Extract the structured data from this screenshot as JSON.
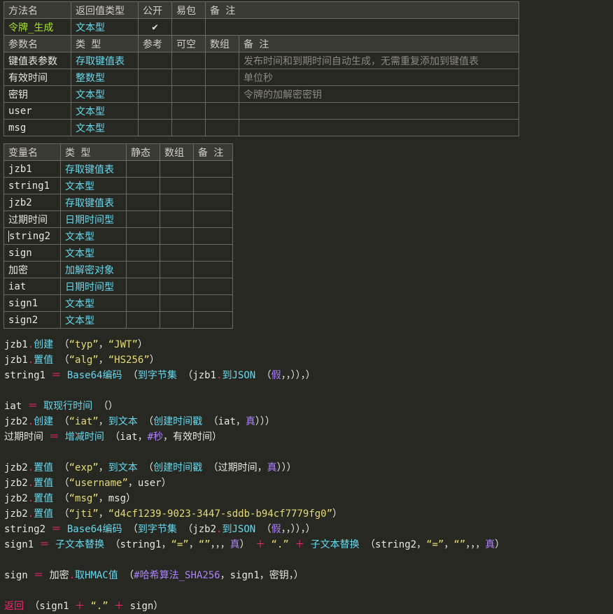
{
  "method_table": {
    "header": [
      "方法名",
      "返回值类型",
      "公开",
      "易包",
      "备 注"
    ],
    "method": {
      "name": "令牌_生成",
      "return_type": "文本型",
      "public_check": "✔",
      "easy_pkg": "",
      "note": ""
    },
    "param_header": [
      "参数名",
      "类 型",
      "参考",
      "可空",
      "数组",
      "备 注"
    ],
    "params": [
      {
        "name": "键值表参数",
        "type": "存取键值表",
        "note": "发布时间和到期时间自动生成，无需重复添加到键值表"
      },
      {
        "name": "有效时间",
        "type": "整数型",
        "note": "单位秒"
      },
      {
        "name": "密钥",
        "type": "文本型",
        "note": "令牌的加解密密钥"
      },
      {
        "name": "user",
        "type": "文本型",
        "note": ""
      },
      {
        "name": "msg",
        "type": "文本型",
        "note": ""
      }
    ]
  },
  "var_table": {
    "header": [
      "变量名",
      "类 型",
      "静态",
      "数组",
      "备 注"
    ],
    "vars": [
      {
        "name": "jzb1",
        "type": "存取键值表"
      },
      {
        "name": "string1",
        "type": "文本型"
      },
      {
        "name": "jzb2",
        "type": "存取键值表"
      },
      {
        "name": "过期时间",
        "type": "日期时间型"
      },
      {
        "name": "string2",
        "type": "文本型"
      },
      {
        "name": "sign",
        "type": "文本型"
      },
      {
        "name": "加密",
        "type": "加解密对象"
      },
      {
        "name": "iat",
        "type": "日期时间型"
      },
      {
        "name": "sign1",
        "type": "文本型"
      },
      {
        "name": "sign2",
        "type": "文本型"
      }
    ]
  },
  "code": {
    "l1": {
      "a": "jzb1",
      "b": ".",
      "c": "创建",
      "d": " （",
      "e": "“typ”",
      "f": "，",
      "g": "“JWT”",
      "h": "）"
    },
    "l2": {
      "a": "jzb1",
      "b": ".",
      "c": "置值",
      "d": " （",
      "e": "“alg”",
      "f": "，",
      "g": "“HS256”",
      "h": "）"
    },
    "l3": {
      "a": "string1",
      "b": " ＝ ",
      "c": "Base64编码",
      "d": " （",
      "e": "到字节集",
      "f": " （jzb1",
      "g": ".",
      "h": "到JSON",
      "i": " （",
      "j": "假",
      "k": "，，））",
      "l": "，）"
    },
    "l5": {
      "a": "iat",
      "b": " ＝ ",
      "c": "取现行时间",
      "d": " （）"
    },
    "l6": {
      "a": "jzb2",
      "b": ".",
      "c": "创建",
      "d": " （",
      "e": "“iat”",
      "f": "，",
      "g": "到文本",
      "h": " （",
      "i": "创建时间戳",
      "j": " （iat，",
      "k": "真",
      "l": "）））"
    },
    "l7": {
      "a": "过期时间",
      "b": " ＝ ",
      "c": "增减时间",
      "d": " （iat，",
      "e": "#秒",
      "f": "，有效时间）"
    },
    "l9": {
      "a": "jzb2",
      "b": ".",
      "c": "置值",
      "d": " （",
      "e": "“exp”",
      "f": "，",
      "g": "到文本",
      "h": " （",
      "i": "创建时间戳",
      "j": " （过期时间，",
      "k": "真",
      "l": "）））"
    },
    "l10": {
      "a": "jzb2",
      "b": ".",
      "c": "置值",
      "d": " （",
      "e": "“username”",
      "f": "，user）"
    },
    "l11": {
      "a": "jzb2",
      "b": ".",
      "c": "置值",
      "d": " （",
      "e": "“msg”",
      "f": "，msg）"
    },
    "l12": {
      "a": "jzb2",
      "b": ".",
      "c": "置值",
      "d": " （",
      "e": "“jti”",
      "f": "，",
      "g": "“d4cf1239-9023-3447-sddb-b94cf7779fg0”",
      "h": "）"
    },
    "l13": {
      "a": "string2",
      "b": " ＝ ",
      "c": "Base64编码",
      "d": " （",
      "e": "到字节集",
      "f": " （jzb2",
      "g": ".",
      "h": "到JSON",
      "i": " （",
      "j": "假",
      "k": "，，））",
      "l": "，）"
    },
    "l14": {
      "a": "sign1",
      "b": " ＝ ",
      "c": "子文本替换",
      "d": " （string1，",
      "e": "“=”",
      "f": "，",
      "g": "“”",
      "h": "，，，",
      "i": "真",
      "j": "）",
      "k": " ＋ ",
      "l": "“.”",
      "m": " ＋ ",
      "n": "子文本替换",
      "o": " （string2，",
      "p": "“=”",
      "q": "，",
      "r": "“”",
      "s": "，，，",
      "t": "真",
      "u": "）"
    },
    "l16": {
      "a": "sign",
      "b": " ＝ ",
      "c": "加密",
      "d": ".",
      "e": "取HMAC值",
      "f": " （",
      "g": "#哈希算法_SHA256",
      "h": "，sign1，密钥，）"
    },
    "l18": {
      "a": "返回",
      "b": " （sign1",
      "c": " ＋ ",
      "d": "“.”",
      "e": " ＋ ",
      "f": "sign）"
    }
  }
}
